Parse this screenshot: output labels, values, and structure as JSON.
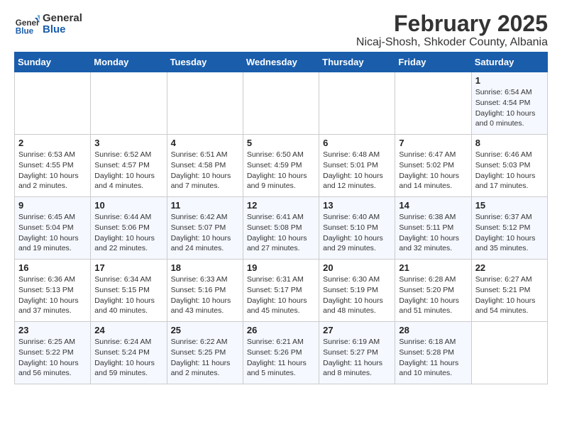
{
  "logo": {
    "line1": "General",
    "line2": "Blue"
  },
  "title": "February 2025",
  "subtitle": "Nicaj-Shosh, Shkoder County, Albania",
  "weekdays": [
    "Sunday",
    "Monday",
    "Tuesday",
    "Wednesday",
    "Thursday",
    "Friday",
    "Saturday"
  ],
  "weeks": [
    [
      {
        "day": "",
        "info": ""
      },
      {
        "day": "",
        "info": ""
      },
      {
        "day": "",
        "info": ""
      },
      {
        "day": "",
        "info": ""
      },
      {
        "day": "",
        "info": ""
      },
      {
        "day": "",
        "info": ""
      },
      {
        "day": "1",
        "info": "Sunrise: 6:54 AM\nSunset: 4:54 PM\nDaylight: 10 hours\nand 0 minutes."
      }
    ],
    [
      {
        "day": "2",
        "info": "Sunrise: 6:53 AM\nSunset: 4:55 PM\nDaylight: 10 hours\nand 2 minutes."
      },
      {
        "day": "3",
        "info": "Sunrise: 6:52 AM\nSunset: 4:57 PM\nDaylight: 10 hours\nand 4 minutes."
      },
      {
        "day": "4",
        "info": "Sunrise: 6:51 AM\nSunset: 4:58 PM\nDaylight: 10 hours\nand 7 minutes."
      },
      {
        "day": "5",
        "info": "Sunrise: 6:50 AM\nSunset: 4:59 PM\nDaylight: 10 hours\nand 9 minutes."
      },
      {
        "day": "6",
        "info": "Sunrise: 6:48 AM\nSunset: 5:01 PM\nDaylight: 10 hours\nand 12 minutes."
      },
      {
        "day": "7",
        "info": "Sunrise: 6:47 AM\nSunset: 5:02 PM\nDaylight: 10 hours\nand 14 minutes."
      },
      {
        "day": "8",
        "info": "Sunrise: 6:46 AM\nSunset: 5:03 PM\nDaylight: 10 hours\nand 17 minutes."
      }
    ],
    [
      {
        "day": "9",
        "info": "Sunrise: 6:45 AM\nSunset: 5:04 PM\nDaylight: 10 hours\nand 19 minutes."
      },
      {
        "day": "10",
        "info": "Sunrise: 6:44 AM\nSunset: 5:06 PM\nDaylight: 10 hours\nand 22 minutes."
      },
      {
        "day": "11",
        "info": "Sunrise: 6:42 AM\nSunset: 5:07 PM\nDaylight: 10 hours\nand 24 minutes."
      },
      {
        "day": "12",
        "info": "Sunrise: 6:41 AM\nSunset: 5:08 PM\nDaylight: 10 hours\nand 27 minutes."
      },
      {
        "day": "13",
        "info": "Sunrise: 6:40 AM\nSunset: 5:10 PM\nDaylight: 10 hours\nand 29 minutes."
      },
      {
        "day": "14",
        "info": "Sunrise: 6:38 AM\nSunset: 5:11 PM\nDaylight: 10 hours\nand 32 minutes."
      },
      {
        "day": "15",
        "info": "Sunrise: 6:37 AM\nSunset: 5:12 PM\nDaylight: 10 hours\nand 35 minutes."
      }
    ],
    [
      {
        "day": "16",
        "info": "Sunrise: 6:36 AM\nSunset: 5:13 PM\nDaylight: 10 hours\nand 37 minutes."
      },
      {
        "day": "17",
        "info": "Sunrise: 6:34 AM\nSunset: 5:15 PM\nDaylight: 10 hours\nand 40 minutes."
      },
      {
        "day": "18",
        "info": "Sunrise: 6:33 AM\nSunset: 5:16 PM\nDaylight: 10 hours\nand 43 minutes."
      },
      {
        "day": "19",
        "info": "Sunrise: 6:31 AM\nSunset: 5:17 PM\nDaylight: 10 hours\nand 45 minutes."
      },
      {
        "day": "20",
        "info": "Sunrise: 6:30 AM\nSunset: 5:19 PM\nDaylight: 10 hours\nand 48 minutes."
      },
      {
        "day": "21",
        "info": "Sunrise: 6:28 AM\nSunset: 5:20 PM\nDaylight: 10 hours\nand 51 minutes."
      },
      {
        "day": "22",
        "info": "Sunrise: 6:27 AM\nSunset: 5:21 PM\nDaylight: 10 hours\nand 54 minutes."
      }
    ],
    [
      {
        "day": "23",
        "info": "Sunrise: 6:25 AM\nSunset: 5:22 PM\nDaylight: 10 hours\nand 56 minutes."
      },
      {
        "day": "24",
        "info": "Sunrise: 6:24 AM\nSunset: 5:24 PM\nDaylight: 10 hours\nand 59 minutes."
      },
      {
        "day": "25",
        "info": "Sunrise: 6:22 AM\nSunset: 5:25 PM\nDaylight: 11 hours\nand 2 minutes."
      },
      {
        "day": "26",
        "info": "Sunrise: 6:21 AM\nSunset: 5:26 PM\nDaylight: 11 hours\nand 5 minutes."
      },
      {
        "day": "27",
        "info": "Sunrise: 6:19 AM\nSunset: 5:27 PM\nDaylight: 11 hours\nand 8 minutes."
      },
      {
        "day": "28",
        "info": "Sunrise: 6:18 AM\nSunset: 5:28 PM\nDaylight: 11 hours\nand 10 minutes."
      },
      {
        "day": "",
        "info": ""
      }
    ]
  ]
}
